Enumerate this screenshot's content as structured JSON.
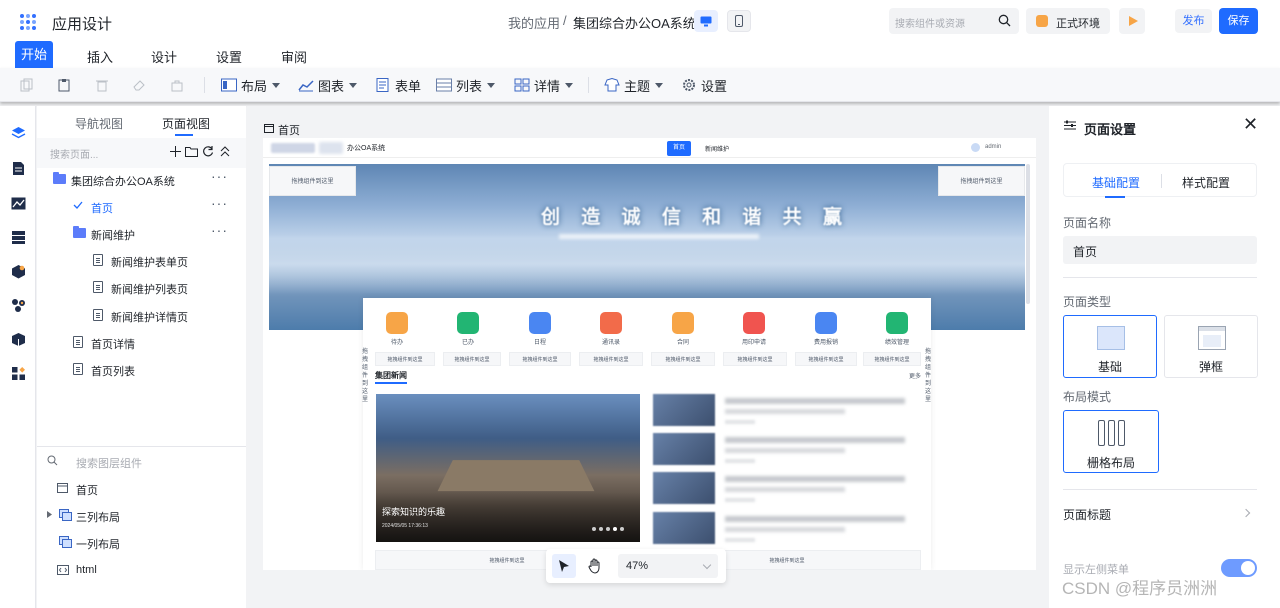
{
  "header": {
    "app_title": "应用设计",
    "breadcrumb_parent": "我的应用",
    "breadcrumb_sep": "/",
    "breadcrumb_current": "集团综合办公OA系统",
    "search_placeholder": "搜索组件或资源",
    "env_label": "正式环境",
    "publish_label": "发布",
    "save_label": "保存"
  },
  "menu": {
    "tabs": [
      "开始",
      "插入",
      "设计",
      "设置",
      "审阅"
    ],
    "active": "开始"
  },
  "toolbar": {
    "items": [
      {
        "label": "布局"
      },
      {
        "label": "图表"
      },
      {
        "label": "表单"
      },
      {
        "label": "列表"
      },
      {
        "label": "详情"
      },
      {
        "label": "主题"
      },
      {
        "label": "设置"
      }
    ]
  },
  "tree_panel": {
    "tabs": [
      "导航视图",
      "页面视图"
    ],
    "active_tab": "页面视图",
    "search_placeholder": "搜索页面...",
    "nodes": [
      {
        "label": "集团综合办公OA系统",
        "kind": "folder"
      },
      {
        "label": "首页",
        "kind": "page",
        "selected": true
      },
      {
        "label": "新闻维护",
        "kind": "folder"
      },
      {
        "label": "新闻维护表单页",
        "kind": "doc"
      },
      {
        "label": "新闻维护列表页",
        "kind": "doc"
      },
      {
        "label": "新闻维护详情页",
        "kind": "doc"
      },
      {
        "label": "首页详情",
        "kind": "doc"
      },
      {
        "label": "首页列表",
        "kind": "doc"
      }
    ],
    "layer_search_placeholder": "搜索图层组件",
    "layers": [
      {
        "label": "首页"
      },
      {
        "label": "三列布局"
      },
      {
        "label": "一列布局"
      },
      {
        "label": "html"
      }
    ]
  },
  "canvas": {
    "page_label": "首页",
    "site_title": "办公OA系统",
    "nav_active": "首页",
    "nav_item": "新闻维护",
    "user": "admin",
    "placeholder_text": "拖拽组件到这里",
    "banner_title": "创 造 诚 信 和 谐 共 赢",
    "quick_items": [
      "待办",
      "已办",
      "日程",
      "通讯录",
      "合同",
      "用印申请",
      "费用报销",
      "绩效管理"
    ],
    "side_vertical_text": "拖拽组件到这里",
    "news_heading": "集团新闻",
    "news_more": "更多",
    "news_caption": "探索知识的乐趣",
    "news_date": "2024/05/05 17:36:13",
    "zoom": "47%"
  },
  "right_panel": {
    "title": "页面设置",
    "tabs": [
      "基础配置",
      "样式配置"
    ],
    "active_tab": "基础配置",
    "page_name_label": "页面名称",
    "page_name_value": "首页",
    "page_type_label": "页面类型",
    "page_types": [
      "基础",
      "弹框"
    ],
    "layout_mode_label": "布局模式",
    "layout_mode_value": "栅格布局",
    "page_title_label": "页面标题",
    "left_menu_label": "显示左侧菜单"
  },
  "watermark": "CSDN @程序员洲洲",
  "colors": {
    "primary": "#1f6bff",
    "accent_orange": "#f7a547"
  }
}
